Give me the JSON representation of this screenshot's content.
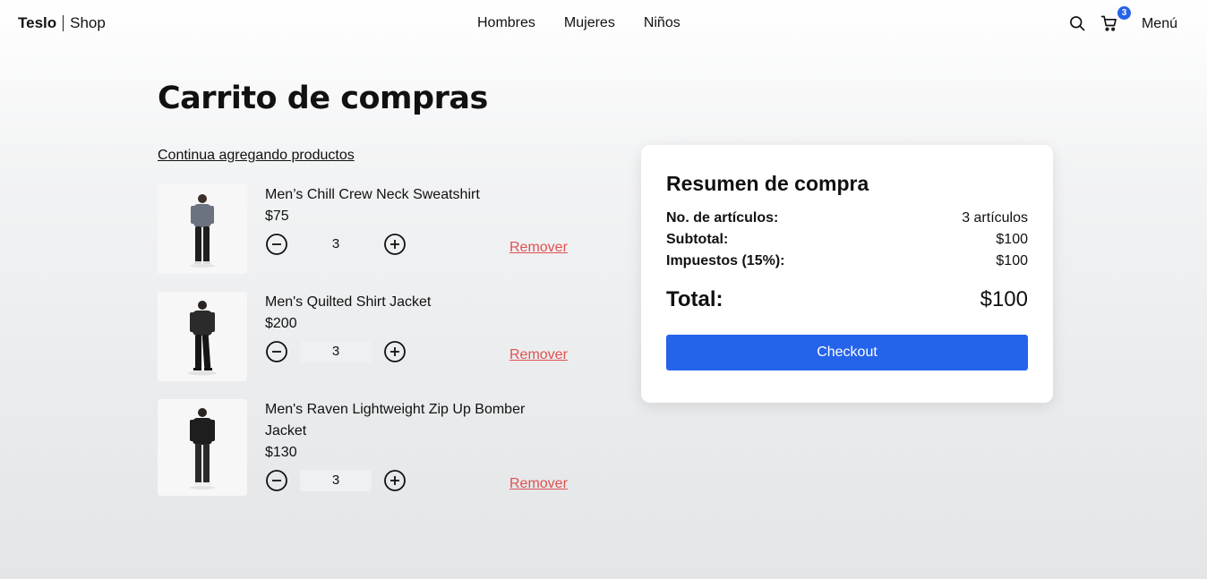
{
  "header": {
    "brand_name": "Teslo",
    "brand_suffix": "Shop",
    "nav": [
      "Hombres",
      "Mujeres",
      "Niños"
    ],
    "cart_count": "3",
    "menu_label": "Menú",
    "icons": {
      "search": "search-icon",
      "cart": "cart-icon"
    }
  },
  "page": {
    "title": "Carrito de compras",
    "continue_link": "Continua agregando productos"
  },
  "cart": {
    "items": [
      {
        "title": "Men’s Chill Crew Neck Sweatshirt",
        "price": "$75",
        "quantity": "3",
        "remove_label": "Remover"
      },
      {
        "title": "Men's Quilted Shirt Jacket",
        "price": "$200",
        "quantity": "3",
        "remove_label": "Remover"
      },
      {
        "title": "Men's Raven Lightweight Zip Up Bomber Jacket",
        "price": "$130",
        "quantity": "3",
        "remove_label": "Remover"
      }
    ]
  },
  "summary": {
    "title": "Resumen de compra",
    "rows": [
      {
        "label": "No. de artículos:",
        "value": "3 artículos"
      },
      {
        "label": "Subtotal:",
        "value": "$100"
      },
      {
        "label": "Impuestos (15%):",
        "value": "$100"
      }
    ],
    "total_label": "Total:",
    "total_value": "$100",
    "checkout_label": "Checkout"
  },
  "colors": {
    "accent": "#2563eb",
    "remove": "#e05151",
    "badge": "#2563eb"
  }
}
